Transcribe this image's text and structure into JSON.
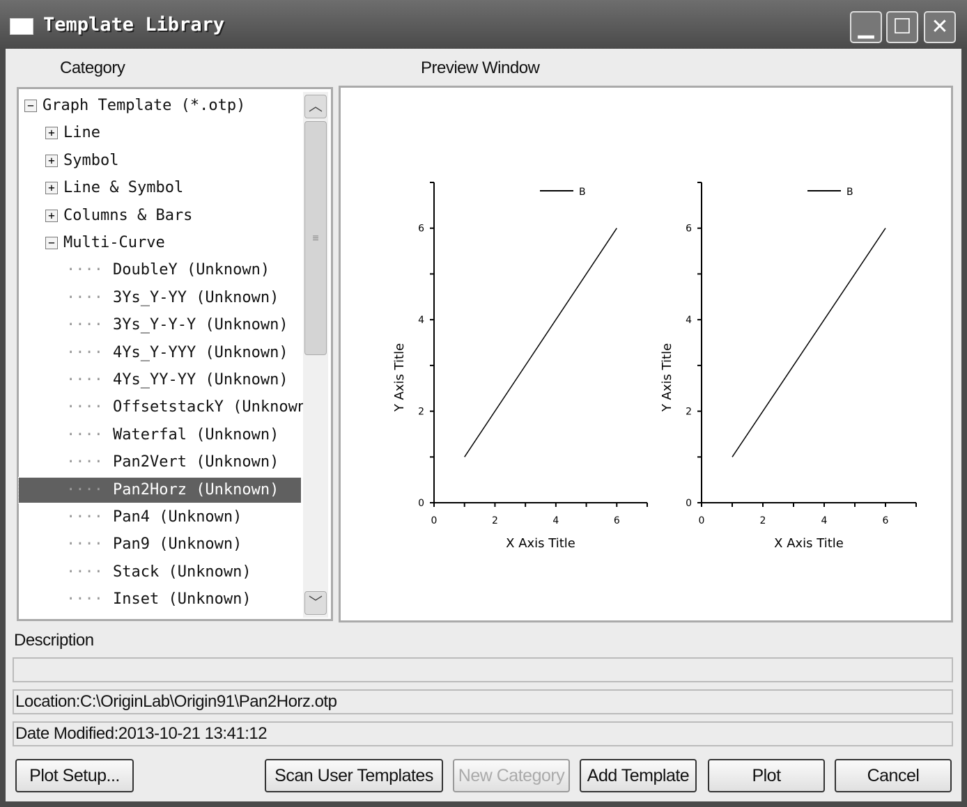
{
  "window": {
    "title": "Template Library",
    "controls": [
      "minimize",
      "maximize",
      "close"
    ]
  },
  "labels": {
    "category": "Category",
    "preview": "Preview Window",
    "description": "Description"
  },
  "tree": {
    "items": [
      {
        "label": "Graph Template (*.otp)",
        "level": 0,
        "toggle": "-"
      },
      {
        "label": "Line",
        "level": 1,
        "toggle": "+"
      },
      {
        "label": "Symbol",
        "level": 1,
        "toggle": "+"
      },
      {
        "label": "Line & Symbol",
        "level": 1,
        "toggle": "+"
      },
      {
        "label": "Columns & Bars",
        "level": 1,
        "toggle": "+"
      },
      {
        "label": "Multi-Curve",
        "level": 1,
        "toggle": "-"
      },
      {
        "label": "DoubleY (Unknown)",
        "level": 2
      },
      {
        "label": "3Ys_Y-YY (Unknown)",
        "level": 2
      },
      {
        "label": "3Ys_Y-Y-Y (Unknown)",
        "level": 2
      },
      {
        "label": "4Ys_Y-YYY (Unknown)",
        "level": 2
      },
      {
        "label": "4Ys_YY-YY (Unknown)",
        "level": 2
      },
      {
        "label": "OffsetstackY (Unknown)",
        "level": 2
      },
      {
        "label": "Waterfal (Unknown)",
        "level": 2
      },
      {
        "label": "Pan2Vert (Unknown)",
        "level": 2
      },
      {
        "label": "Pan2Horz (Unknown)",
        "level": 2,
        "selected": true
      },
      {
        "label": "Pan4 (Unknown)",
        "level": 2
      },
      {
        "label": "Pan9 (Unknown)",
        "level": 2
      },
      {
        "label": "Stack (Unknown)",
        "level": 2
      },
      {
        "label": "Inset (Unknown)",
        "level": 2
      }
    ]
  },
  "description": {
    "text": "",
    "location": "Location:C:\\OriginLab\\Origin91\\Pan2Horz.otp",
    "date_modified": "Date Modified:2013-10-21 13:41:12"
  },
  "buttons": {
    "plot_setup": "Plot Setup...",
    "scan": "Scan User Templates",
    "new_category": "New Category",
    "add_template": "Add Template",
    "plot": "Plot",
    "cancel": "Cancel"
  },
  "chart_data": [
    {
      "type": "line",
      "xlabel": "X Axis Title",
      "ylabel": "Y Axis Title",
      "xlim": [
        0,
        7
      ],
      "ylim": [
        0,
        7
      ],
      "xticks": [
        "0",
        "2",
        "4",
        "6"
      ],
      "yticks": [
        "0",
        "2",
        "4",
        "6"
      ],
      "legend": "top-right",
      "series": [
        {
          "name": "B",
          "x": [
            1,
            6
          ],
          "y": [
            1,
            6
          ]
        }
      ]
    },
    {
      "type": "line",
      "xlabel": "X Axis Title",
      "ylabel": "Y Axis Title",
      "xlim": [
        0,
        7
      ],
      "ylim": [
        0,
        7
      ],
      "xticks": [
        "0",
        "2",
        "4",
        "6"
      ],
      "yticks": [
        "0",
        "2",
        "4",
        "6"
      ],
      "legend": "top-right",
      "series": [
        {
          "name": "B",
          "x": [
            1,
            6
          ],
          "y": [
            1,
            6
          ]
        }
      ]
    }
  ]
}
